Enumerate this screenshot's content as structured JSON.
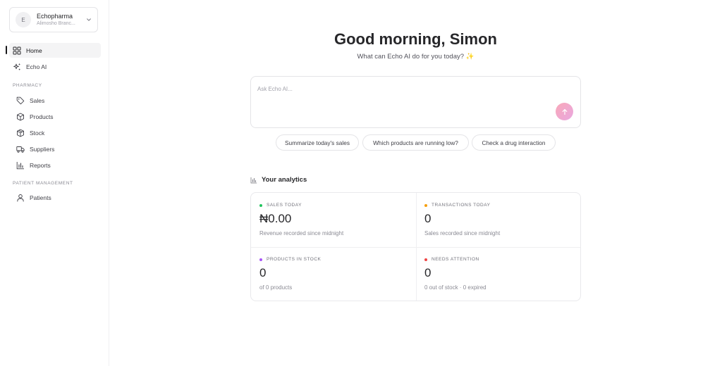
{
  "org": {
    "avatar_letter": "E",
    "name": "Echopharma",
    "branch": "Alimosho Branc..."
  },
  "nav": {
    "home": "Home",
    "echo_ai": "Echo AI",
    "pharmacy_section": "PHARMACY",
    "sales": "Sales",
    "products": "Products",
    "stock": "Stock",
    "suppliers": "Suppliers",
    "reports": "Reports",
    "patient_section": "PATIENT MANAGEMENT",
    "patients": "Patients"
  },
  "main": {
    "greeting": "Good morning, Simon",
    "subtitle": "What can Echo AI do for you today?",
    "prompt_placeholder": "Ask Echo AI...",
    "suggestions": [
      "Summarize today's sales",
      "Which products are running low?",
      "Check a drug interaction"
    ],
    "analytics_title": "Your analytics"
  },
  "stats": [
    {
      "label": "SALES TODAY",
      "value": "₦0.00",
      "sub": "Revenue recorded since midnight",
      "dot_color": "#22c55e"
    },
    {
      "label": "TRANSACTIONS TODAY",
      "value": "0",
      "sub": "Sales recorded since midnight",
      "dot_color": "#f59e0b"
    },
    {
      "label": "PRODUCTS IN STOCK",
      "value": "0",
      "sub": "of 0 products",
      "dot_color": "#a855f7"
    },
    {
      "label": "NEEDS ATTENTION",
      "value": "0",
      "sub": "0 out of stock · 0 expired",
      "dot_color": "#ef4444"
    }
  ],
  "colors": {
    "send_button": "#f4a8c8",
    "active_indicator": "#18181b"
  },
  "icons": {
    "home": "grid-icon",
    "echo_ai": "sparkles-icon",
    "sales": "tag-icon",
    "products": "box-icon",
    "stock": "package-icon",
    "suppliers": "truck-icon",
    "reports": "bar-chart-icon",
    "patients": "user-icon",
    "send": "arrow-up-icon",
    "analytics": "bar-chart-icon"
  }
}
